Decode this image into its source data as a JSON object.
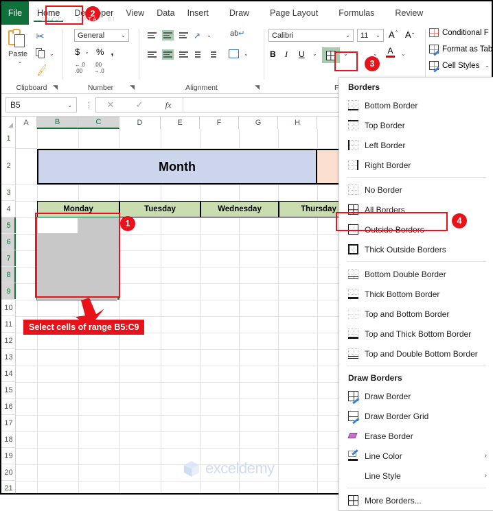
{
  "ribbon": {
    "file_tab": "File",
    "tabs": [
      {
        "label": "Home",
        "active": true
      },
      {
        "label": "Developer",
        "active": false
      },
      {
        "label": "View",
        "active": false
      },
      {
        "label": "Data",
        "active": false
      },
      {
        "label": "Insert",
        "active": false
      },
      {
        "label": "Draw",
        "active": false
      },
      {
        "label": "Page Layout",
        "active": false
      },
      {
        "label": "Formulas",
        "active": false
      },
      {
        "label": "Review",
        "active": false
      }
    ],
    "groups": {
      "clipboard": {
        "label": "Clipboard",
        "paste": "Paste"
      },
      "number": {
        "label": "Number",
        "format": "General",
        "currency": "$",
        "percent": "%",
        "comma": ","
      },
      "alignment": {
        "label": "Alignment"
      },
      "font": {
        "label": "F",
        "name": "Calibri",
        "size": "11",
        "bold": "B",
        "italic": "I",
        "underline": "U"
      },
      "styles": {
        "conditional": "Conditional F",
        "format_table": "Format as Tab",
        "cell_styles": "Cell Styles"
      }
    }
  },
  "formula_bar": {
    "name_box": "B5",
    "cancel_icon": "✕",
    "enter_icon": "✓",
    "fx": "fx",
    "value": ""
  },
  "grid": {
    "columns": [
      "A",
      "B",
      "C",
      "D",
      "E",
      "F",
      "G",
      "H"
    ],
    "selected_columns": [
      "B",
      "C"
    ],
    "rows": [
      "1",
      "2",
      "3",
      "4",
      "5",
      "6",
      "7",
      "8",
      "9",
      "10",
      "11",
      "12",
      "13",
      "14",
      "15",
      "16",
      "17",
      "18",
      "19",
      "20",
      "21"
    ],
    "selected_rows": [
      "5",
      "6",
      "7",
      "8",
      "9"
    ],
    "title_cell": "Month",
    "day_headers": [
      "Monday",
      "Tuesday",
      "Wednesday",
      "Thursday"
    ],
    "colors": {
      "title_fill": "#ccd5ec",
      "peach_fill": "#fbe0d0",
      "day_fill": "#c9ddb0",
      "selection_fill": "#c8c8c8",
      "selection_border": "#1f7a4d"
    }
  },
  "annotations": {
    "badge1": "1",
    "badge2": "2",
    "badge3": "3",
    "badge4": "4",
    "callout": "Select cells of range B5:C9",
    "accent": "#e8131a"
  },
  "borders_menu": {
    "title": "Borders",
    "items": [
      {
        "label": "Bottom Border",
        "icon": "bottom-border-icon",
        "kind": "bottom"
      },
      {
        "label": "Top Border",
        "icon": "top-border-icon",
        "kind": "top"
      },
      {
        "label": "Left Border",
        "icon": "left-border-icon",
        "kind": "left"
      },
      {
        "label": "Right Border",
        "icon": "right-border-icon",
        "kind": "right"
      },
      {
        "label": "No Border",
        "icon": "no-border-icon",
        "kind": "none"
      },
      {
        "label": "All Borders",
        "icon": "all-borders-icon",
        "kind": "all"
      },
      {
        "label": "Outside Borders",
        "icon": "outside-borders-icon",
        "kind": "outside",
        "highlighted": true
      },
      {
        "label": "Thick Outside Borders",
        "icon": "thick-outside-borders-icon",
        "kind": "thick-outside"
      },
      {
        "label": "Bottom Double Border",
        "icon": "bottom-double-border-icon",
        "kind": "double-bottom"
      },
      {
        "label": "Thick Bottom Border",
        "icon": "thick-bottom-border-icon",
        "kind": "thick-bottom"
      },
      {
        "label": "Top and Bottom Border",
        "icon": "top-and-bottom-border-icon",
        "kind": "top-bottom"
      },
      {
        "label": "Top and Thick Bottom Border",
        "icon": "top-and-thick-bottom-border-icon",
        "kind": "top-thick-bottom"
      },
      {
        "label": "Top and Double Bottom Border",
        "icon": "top-and-double-bottom-border-icon",
        "kind": "top-double-bottom"
      }
    ],
    "draw_section_title": "Draw Borders",
    "draw_items": [
      {
        "label": "Draw Border",
        "icon": "draw-border-icon",
        "kind": "draw"
      },
      {
        "label": "Draw Border Grid",
        "icon": "draw-border-grid-icon",
        "kind": "draw-grid"
      },
      {
        "label": "Erase Border",
        "icon": "erase-border-icon",
        "kind": "erase"
      },
      {
        "label": "Line Color",
        "icon": "line-color-icon",
        "kind": "line-color",
        "submenu": "›"
      },
      {
        "label": "Line Style",
        "icon": "",
        "kind": "line-style",
        "submenu": "›"
      }
    ],
    "more": {
      "label": "More Borders...",
      "icon": "more-borders-icon",
      "kind": "all"
    }
  },
  "watermark": {
    "name": "exceldemy",
    "tagline": "EXCEL · DATA · BI"
  }
}
